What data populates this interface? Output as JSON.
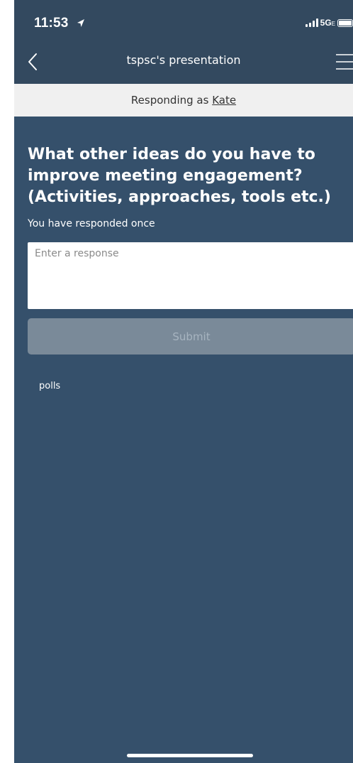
{
  "status_bar": {
    "time": "11:53",
    "network": "5G",
    "network_suffix": "E"
  },
  "nav": {
    "title": "tspsc's presentation"
  },
  "banner": {
    "prefix": "Responding as ",
    "user": "Kate"
  },
  "question": {
    "text": "What other ideas do you have to improve meeting engagement? (Activities, approaches, tools etc.)",
    "responded_count": "You have responded once"
  },
  "response": {
    "placeholder": "Enter a response",
    "value": ""
  },
  "submit": {
    "label": "Submit"
  },
  "footer": {
    "polls_label": "polls"
  },
  "colors": {
    "background": "#35506b",
    "header": "#33495f",
    "banner": "#f0f0f0",
    "submit_disabled": "#7a8a99"
  }
}
